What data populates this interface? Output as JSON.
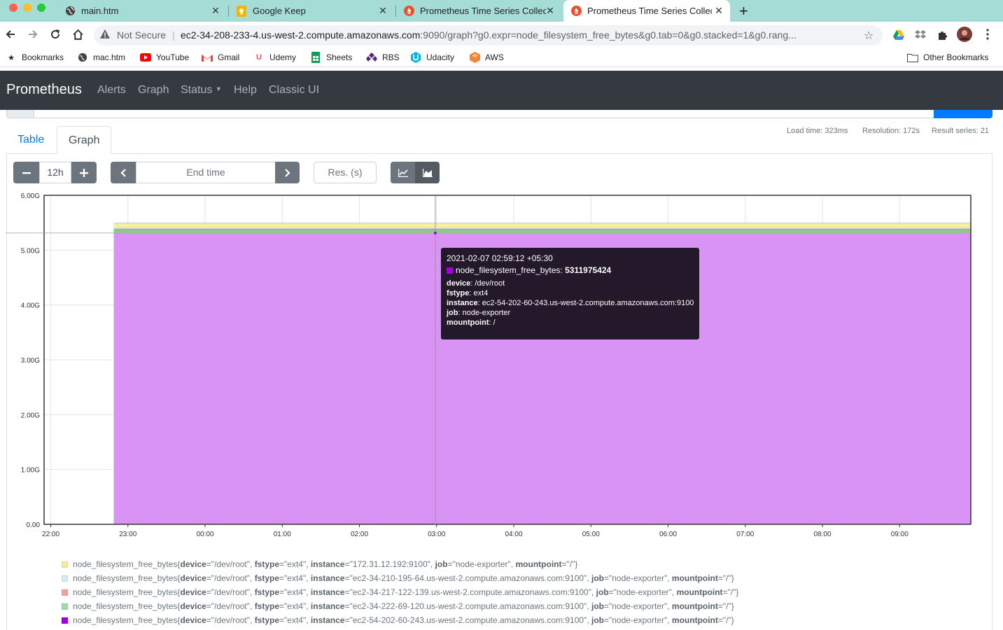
{
  "browser": {
    "tabs": [
      {
        "title": "main.htm",
        "icon": "globe-icon"
      },
      {
        "title": "Google Keep",
        "icon": "keep-icon"
      },
      {
        "title": "Prometheus Time Series Collec",
        "icon": "prometheus-icon"
      },
      {
        "title": "Prometheus Time Series Collec",
        "icon": "prometheus-icon",
        "active": true
      }
    ],
    "security_label": "Not Secure",
    "url_host": "ec2-34-208-233-4.us-west-2.compute.amazonaws.com",
    "url_rest": ":9090/graph?g0.expr=node_filesystem_free_bytes&g0.tab=0&g0.stacked=1&g0.rang...",
    "bookmarks": [
      {
        "label": "Bookmarks",
        "icon": "star-icon"
      },
      {
        "label": "mac.htm",
        "icon": "globe-icon"
      },
      {
        "label": "YouTube",
        "icon": "youtube-icon"
      },
      {
        "label": "Gmail",
        "icon": "gmail-icon"
      },
      {
        "label": "Udemy",
        "icon": "udemy-icon"
      },
      {
        "label": "Sheets",
        "icon": "sheets-icon"
      },
      {
        "label": "RBS",
        "icon": "rbs-icon"
      },
      {
        "label": "Udacity",
        "icon": "udacity-icon"
      },
      {
        "label": "AWS",
        "icon": "aws-icon"
      }
    ],
    "other_bookmarks": "Other Bookmarks"
  },
  "nav": {
    "brand": "Prometheus",
    "links": [
      "Alerts",
      "Graph",
      "Status",
      "Help",
      "Classic UI"
    ]
  },
  "panel": {
    "tab_table": "Table",
    "tab_graph": "Graph",
    "load_time": "Load time: 323ms",
    "resolution": "Resolution: 172s",
    "result_series": "Result series: 21",
    "range": "12h",
    "end_time_placeholder": "End time",
    "res_placeholder": "Res. (s)"
  },
  "chart_data": {
    "type": "area",
    "stacked": true,
    "x_ticks": [
      "22:00",
      "23:00",
      "00:00",
      "01:00",
      "02:00",
      "03:00",
      "04:00",
      "05:00",
      "06:00",
      "07:00",
      "08:00",
      "09:00"
    ],
    "y_ticks": [
      "0.00",
      "1.00G",
      "2.00G",
      "3.00G",
      "4.00G",
      "5.00G",
      "6.00G"
    ],
    "ylim": [
      0,
      6000000000
    ],
    "data_start": "22:49",
    "data_end": "09:55",
    "series": [
      {
        "name": "ec2-54-202-60-243",
        "value": 5311975424,
        "color": "#d993f4"
      },
      {
        "name": "ec2-34-222-69-120",
        "value": 60000000,
        "color": "#8fc98f"
      },
      {
        "name": "ec2-34-217-122-139",
        "value": 15000000,
        "color": "#e8a0a0"
      },
      {
        "name": "ec2-34-210-195-64",
        "value": 15000000,
        "color": "#c9dff2"
      },
      {
        "name": "172.31.12.192",
        "value": 90000000,
        "color": "#f5f0a0"
      }
    ]
  },
  "tooltip": {
    "time": "2021-02-07 02:59:12 +05:30",
    "series_name": "node_filesystem_free_bytes:",
    "series_value": "5311975424",
    "labels": [
      {
        "k": "device",
        "v": "/dev/root"
      },
      {
        "k": "fstype",
        "v": "ext4"
      },
      {
        "k": "instance",
        "v": "ec2-54-202-60-243.us-west-2.compute.amazonaws.com:9100"
      },
      {
        "k": "job",
        "v": "node-exporter"
      },
      {
        "k": "mountpoint",
        "v": "/"
      }
    ]
  },
  "legend": [
    {
      "color": "#f8e8a0",
      "instance": "\"172.31.12.192:9100\""
    },
    {
      "color": "#d6e9f5",
      "instance": "\"ec2-34-210-195-64.us-west-2.compute.amazonaws.com:9100\""
    },
    {
      "color": "#eba3a3",
      "instance": "\"ec2-34-217-122-139.us-west-2.compute.amazonaws.com:9100\""
    },
    {
      "color": "#a8d8a8",
      "instance": "\"ec2-34-222-69-120.us-west-2.compute.amazonaws.com:9100\""
    },
    {
      "color": "#a000e0",
      "instance": "\"ec2-54-202-60-243.us-west-2.compute.amazonaws.com:9100\""
    }
  ],
  "legend_text": {
    "metric": "node_filesystem_free_bytes{",
    "device_k": "device",
    "device_v": "=\"/dev/root\", ",
    "fstype_k": "fstype",
    "fstype_v": "=\"ext4\", ",
    "instance_k": "instance",
    "job_k": "job",
    "job_v": "=\"node-exporter\", ",
    "mount_k": "mountpoint",
    "mount_v": "=\"/\"}"
  }
}
